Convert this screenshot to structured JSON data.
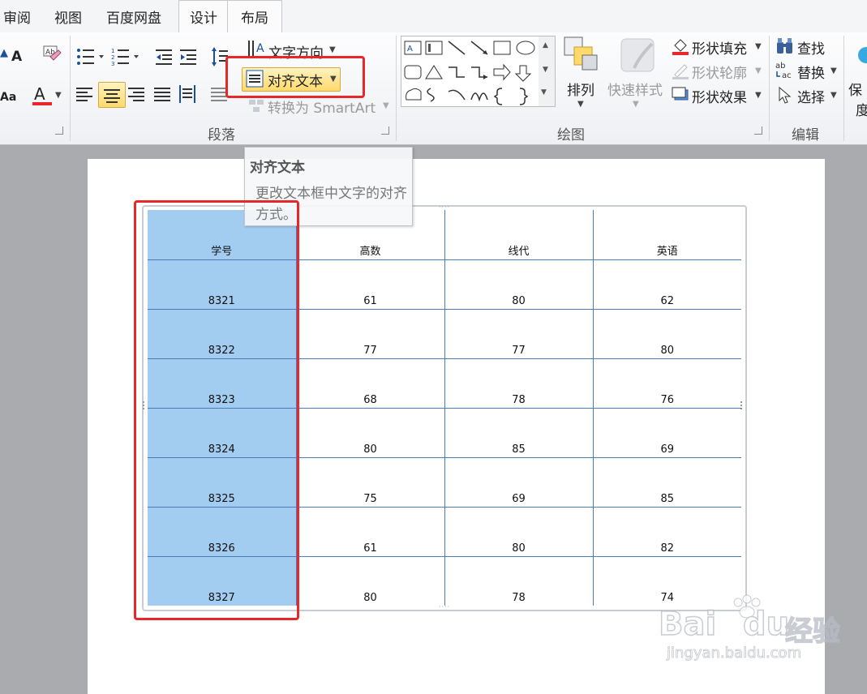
{
  "tabs": [
    "审阅",
    "视图",
    "百度网盘",
    "设计",
    "布局"
  ],
  "ribbon": {
    "paragraph": {
      "text_direction": "文字方向",
      "align_text": "对齐文本",
      "convert_smartart": "转换为 SmartArt",
      "group_label": "段落"
    },
    "drawing": {
      "arrange": "排列",
      "quick_styles": "快速样式",
      "shape_fill": "形状填充",
      "shape_outline": "形状轮廓",
      "shape_effects": "形状效果",
      "group_label": "绘图"
    },
    "editing": {
      "find": "查找",
      "replace": "替换",
      "select": "选择",
      "group_label": "编辑"
    },
    "partial_right": "保",
    "partial_right2": "度",
    "font_a_label": "A",
    "font_aa_label": "Aa",
    "colors": {
      "font_color_bar": "#e8272a",
      "highlight": "#e8272a",
      "selection": "#a3cdf0",
      "table_border": "#4a7bb7"
    }
  },
  "tooltip": {
    "title": "对齐文本",
    "description": "更改文本框中文字的对齐方式。"
  },
  "table": {
    "headers": [
      "学号",
      "高数",
      "线代",
      "英语"
    ],
    "rows": [
      [
        "8321",
        "61",
        "80",
        "62"
      ],
      [
        "8322",
        "77",
        "77",
        "80"
      ],
      [
        "8323",
        "68",
        "78",
        "76"
      ],
      [
        "8324",
        "80",
        "85",
        "69"
      ],
      [
        "8325",
        "75",
        "69",
        "85"
      ],
      [
        "8326",
        "61",
        "80",
        "82"
      ],
      [
        "8327",
        "80",
        "78",
        "74"
      ]
    ]
  },
  "watermark": {
    "brand": "Bai",
    "brand2": "du",
    "cn": "经验",
    "url": "jingyan.baidu.com"
  }
}
